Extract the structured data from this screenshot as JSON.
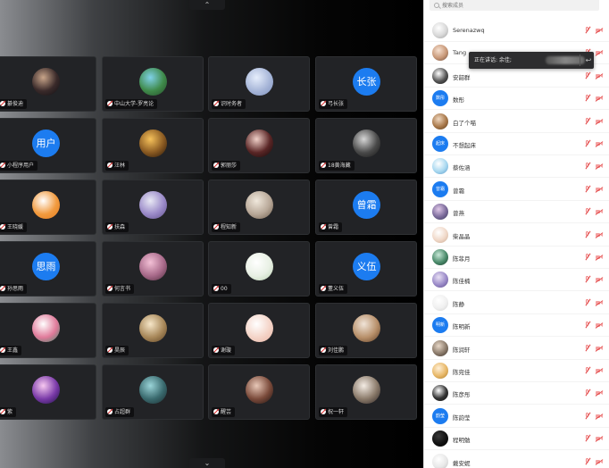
{
  "controls": {
    "scroll_up": "⌃",
    "scroll_down": "⌄"
  },
  "tiles": [
    {
      "name": "綦俊迪",
      "avatar": {
        "type": "photo",
        "colors": [
          "#c9a58a",
          "#3a2a2a",
          "#0e0e12"
        ]
      }
    },
    {
      "name": "中山大学-罗亮论",
      "avatar": {
        "type": "photo",
        "colors": [
          "#7fd1e8",
          "#3f8a4a",
          "#254a2a"
        ]
      }
    },
    {
      "name": "识时务者",
      "avatar": {
        "type": "photo",
        "colors": [
          "#e6eefc",
          "#a7b6d8",
          "#7d8fbd"
        ]
      }
    },
    {
      "name": "弓长张",
      "avatar": {
        "type": "text",
        "text": "长张"
      }
    },
    {
      "name": "小程序用户",
      "avatar": {
        "type": "text",
        "text": "用户"
      }
    },
    {
      "name": "汪林",
      "avatar": {
        "type": "photo",
        "colors": [
          "#f6c15a",
          "#8a5a22",
          "#241408"
        ]
      }
    },
    {
      "name": "郭丽莎",
      "avatar": {
        "type": "photo",
        "colors": [
          "#f0d0c8",
          "#5a2626",
          "#120808"
        ]
      }
    },
    {
      "name": "18黄海藏",
      "avatar": {
        "type": "photo",
        "colors": [
          "#d6d6d6",
          "#4a4a4a",
          "#141414"
        ]
      }
    },
    {
      "name": "王晓媛",
      "avatar": {
        "type": "photo",
        "colors": [
          "#ffffff",
          "#f19a3e",
          "#e27b20"
        ]
      }
    },
    {
      "name": "扶森",
      "avatar": {
        "type": "photo",
        "colors": [
          "#e8e8f4",
          "#9a8ac8",
          "#5e4e88"
        ]
      }
    },
    {
      "name": "程知新",
      "avatar": {
        "type": "photo",
        "colors": [
          "#f0e8dc",
          "#b8a898",
          "#6a5a4a"
        ]
      }
    },
    {
      "name": "曾霜",
      "avatar": {
        "type": "text",
        "text": "曾霜"
      }
    },
    {
      "name": "孙思雨",
      "avatar": {
        "type": "text",
        "text": "思雨"
      }
    },
    {
      "name": "何言书",
      "avatar": {
        "type": "photo",
        "colors": [
          "#f3c0d6",
          "#a86a8a",
          "#4a2a3a"
        ]
      }
    },
    {
      "name": "00",
      "avatar": {
        "type": "photo",
        "colors": [
          "#ffffff",
          "#e8f0e4",
          "#b8d0b0"
        ]
      }
    },
    {
      "name": "董义伍",
      "avatar": {
        "type": "text",
        "text": "义伍"
      }
    },
    {
      "name": "王鑫",
      "avatar": {
        "type": "photo",
        "colors": [
          "#ffffff",
          "#e07a9a",
          "#3a8a6a"
        ]
      }
    },
    {
      "name": "昊辰",
      "avatar": {
        "type": "photo",
        "colors": [
          "#f6e6c8",
          "#a8885a",
          "#5a4022"
        ]
      }
    },
    {
      "name": "谢璇",
      "avatar": {
        "type": "photo",
        "colors": [
          "#ffffff",
          "#f4d4c8",
          "#e8b4a4"
        ]
      }
    },
    {
      "name": "刘佳鹏",
      "avatar": {
        "type": "photo",
        "colors": [
          "#f0e4d8",
          "#b8906a",
          "#5a3a22"
        ]
      }
    },
    {
      "name": "紫",
      "avatar": {
        "type": "photo",
        "colors": [
          "#f7c8f0",
          "#7a3aa8",
          "#1a1040"
        ]
      }
    },
    {
      "name": "占超群",
      "avatar": {
        "type": "photo",
        "colors": [
          "#9ad4d8",
          "#3a6a6e",
          "#1a2a2e"
        ]
      }
    },
    {
      "name": "醒芸",
      "avatar": {
        "type": "photo",
        "colors": [
          "#e8c8b8",
          "#7a4a3a",
          "#1a1010"
        ]
      }
    },
    {
      "name": "祝一轩",
      "avatar": {
        "type": "photo",
        "colors": [
          "#f4ece4",
          "#8a7a6a",
          "#2a2222"
        ]
      }
    }
  ],
  "sidebar": {
    "search_placeholder": "搜索成员",
    "members": [
      {
        "name": "Serenazwq",
        "avatar": {
          "type": "photo",
          "colors": [
            "#ffffff",
            "#d8d8d8",
            "#9a9a9a"
          ]
        }
      },
      {
        "name": "Tang",
        "avatar": {
          "type": "photo",
          "colors": [
            "#f6e0d0",
            "#c89878",
            "#6a4a3a"
          ]
        }
      },
      {
        "name": "安韶群",
        "avatar": {
          "type": "photo",
          "colors": [
            "#ffffff",
            "#555555",
            "#111111"
          ]
        }
      },
      {
        "name": "数彤",
        "avatar": {
          "type": "text",
          "text": "数彤"
        }
      },
      {
        "name": "白了个喵",
        "avatar": {
          "type": "photo",
          "colors": [
            "#f0d8c0",
            "#a8784a",
            "#5a3a1a"
          ]
        }
      },
      {
        "name": "不想起床",
        "avatar": {
          "type": "text",
          "text": "起床"
        }
      },
      {
        "name": "蔡佐涵",
        "avatar": {
          "type": "photo",
          "colors": [
            "#ffffff",
            "#a8d8f0",
            "#5898c8"
          ]
        }
      },
      {
        "name": "曾霜",
        "avatar": {
          "type": "text",
          "text": "曾霜"
        }
      },
      {
        "name": "曾燕",
        "avatar": {
          "type": "photo",
          "colors": [
            "#e0c8e8",
            "#7a6a9a",
            "#3a3a5a"
          ]
        }
      },
      {
        "name": "柴晶晶",
        "avatar": {
          "type": "photo",
          "colors": [
            "#ffffff",
            "#f0d8c8",
            "#c8a890"
          ]
        }
      },
      {
        "name": "陈菲月",
        "avatar": {
          "type": "photo",
          "colors": [
            "#c8e8d8",
            "#4a8a6a",
            "#1a3a2a"
          ]
        }
      },
      {
        "name": "陈佳楠",
        "avatar": {
          "type": "photo",
          "colors": [
            "#e8e0f4",
            "#9a8ac8",
            "#5a4a88"
          ]
        }
      },
      {
        "name": "陈静",
        "avatar": {
          "type": "photo",
          "colors": [
            "#ffffff",
            "#f0f0f0",
            "#d0d0d0"
          ]
        }
      },
      {
        "name": "陈明新",
        "avatar": {
          "type": "text",
          "text": "明新"
        }
      },
      {
        "name": "陈润轩",
        "avatar": {
          "type": "photo",
          "colors": [
            "#e8d8c8",
            "#8a7a6a",
            "#3a302a"
          ]
        }
      },
      {
        "name": "陈宛佳",
        "avatar": {
          "type": "photo",
          "colors": [
            "#fff0d8",
            "#e8b868",
            "#a87828"
          ]
        }
      },
      {
        "name": "陈彦彤",
        "avatar": {
          "type": "photo",
          "colors": [
            "#ffffff",
            "#333333",
            "#111111"
          ]
        }
      },
      {
        "name": "陈韵莹",
        "avatar": {
          "type": "text",
          "text": "韵莹"
        }
      },
      {
        "name": "程明勉",
        "avatar": {
          "type": "photo",
          "colors": [
            "#3a3a3a",
            "#111111",
            "#000000"
          ]
        }
      },
      {
        "name": "戴安妮",
        "avatar": {
          "type": "photo",
          "colors": [
            "#ffffff",
            "#e8e8e8",
            "#bdbdbd"
          ]
        }
      }
    ]
  },
  "tooltip": {
    "label": "正在讲话: 余佳;",
    "close": "↩"
  }
}
